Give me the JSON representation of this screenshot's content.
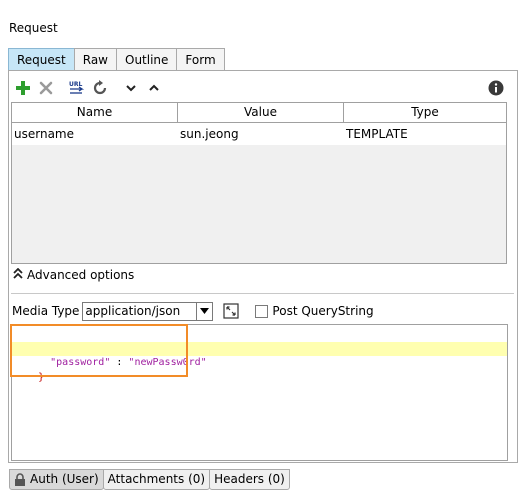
{
  "panel": {
    "title": "Request"
  },
  "tabs": [
    {
      "label": "Request",
      "active": true
    },
    {
      "label": "Raw",
      "active": false
    },
    {
      "label": "Outline",
      "active": false
    },
    {
      "label": "Form",
      "active": false
    }
  ],
  "toolbar": {
    "icons": [
      "add-icon",
      "remove-icon",
      "url-encode-icon",
      "refresh-icon",
      "move-down-icon",
      "move-up-icon",
      "info-icon"
    ],
    "url_icon_text": "URL"
  },
  "params_table": {
    "headers": [
      "Name",
      "Value",
      "Type"
    ],
    "rows": [
      {
        "name": "username",
        "value": "sun.jeong",
        "type": "TEMPLATE"
      }
    ]
  },
  "advanced_options": {
    "label": "Advanced options"
  },
  "media": {
    "label": "Media Type",
    "selected": "application/json",
    "post_querystring_label": "Post QueryString",
    "post_querystring_checked": false
  },
  "body_editor": {
    "lines": [
      "{",
      "  \"password\" : \"newPassw0rd\"",
      "}"
    ],
    "key": "\"password\"",
    "separator": " : ",
    "value": "\"newPassw0rd\""
  },
  "bottom_tabs": [
    {
      "label": "Auth (User)",
      "icon": "lock-icon",
      "active": true
    },
    {
      "label": "Attachments (0)",
      "active": false
    },
    {
      "label": "Headers (0)",
      "active": false
    }
  ],
  "colors": {
    "tab_active": "#c6e6f7",
    "add_green": "#2e9e2e",
    "highlight_line": "#ffffb0",
    "annotation_orange": "#f28c28"
  }
}
